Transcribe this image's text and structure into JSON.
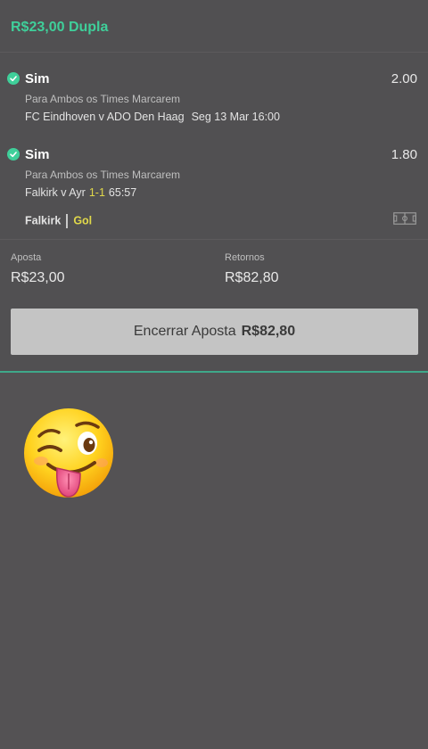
{
  "bet": {
    "title": "R$23,00 Dupla",
    "selections": [
      {
        "name": "Sim",
        "odds": "2.00",
        "market": "Para Ambos os Times Marcarem",
        "event": "FC Eindhoven v ADO Den Haag",
        "date": "Seg 13 Mar 16:00"
      },
      {
        "name": "Sim",
        "odds": "1.80",
        "market": "Para Ambos os Times Marcarem",
        "event": "Falkirk v Ayr",
        "score": "1-1",
        "time": "65:57",
        "live_team": "Falkirk",
        "live_event": "Gol"
      }
    ],
    "stake_label": "Aposta",
    "stake_value": "R$23,00",
    "returns_label": "Retornos",
    "returns_value": "R$82,80",
    "cashout_label": "Encerrar Aposta",
    "cashout_amount": "R$82,80"
  },
  "icons": {
    "check": "check-circle-icon",
    "pitch": "football-pitch-icon",
    "emoji": "winking-tongue-emoji"
  },
  "colors": {
    "accent": "#3fcf9a",
    "highlight": "#e0d84a",
    "background": "#545254",
    "button": "#c4c4c4"
  }
}
